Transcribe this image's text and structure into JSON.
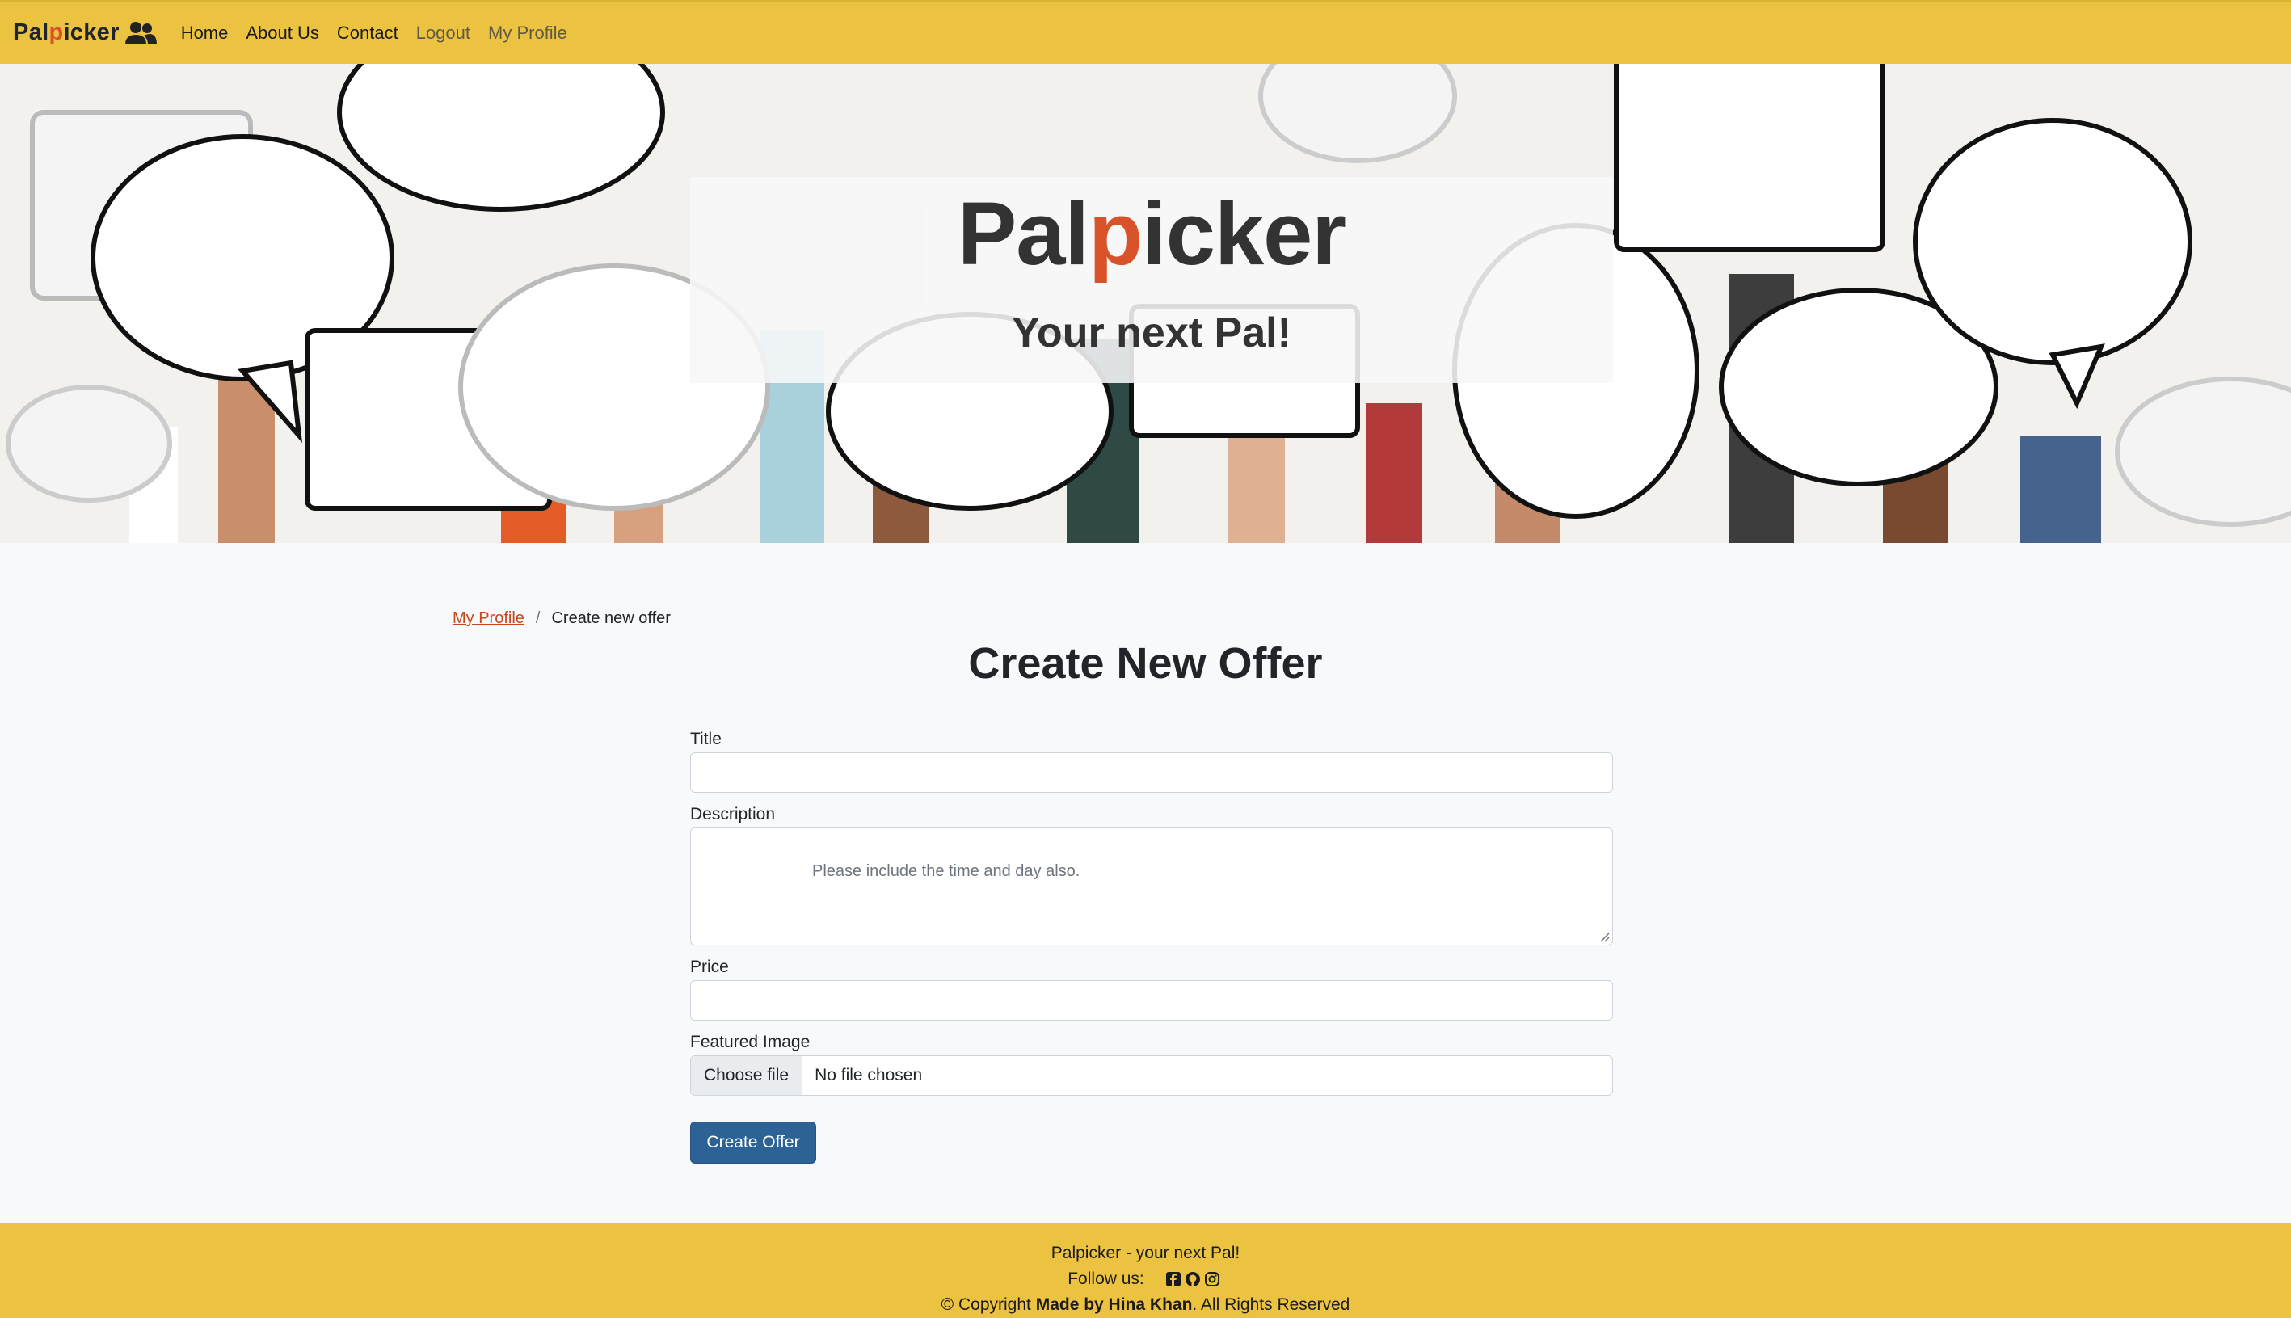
{
  "navbar": {
    "brand_pre": "Pal",
    "brand_p": "p",
    "brand_post": "icker",
    "links": [
      {
        "label": "Home"
      },
      {
        "label": "About Us"
      },
      {
        "label": "Contact"
      },
      {
        "label": "Logout"
      },
      {
        "label": "My Profile"
      }
    ]
  },
  "hero": {
    "title_pre": "Pal",
    "title_p": "p",
    "title_post": "icker",
    "subtitle": "Your next Pal!"
  },
  "breadcrumb": {
    "parent": "My Profile",
    "separator": "/",
    "current": "Create new offer"
  },
  "page_title": "Create New Offer",
  "form": {
    "title_label": "Title",
    "title_value": "",
    "description_label": "Description",
    "description_placeholder": "Please include the time and day also.",
    "price_label": "Price",
    "price_value": "",
    "image_label": "Featured Image",
    "choose_file": "Choose file",
    "file_status": "No file chosen",
    "submit": "Create Offer"
  },
  "footer": {
    "line1": "Palpicker - your next Pal!",
    "follow": "Follow us:",
    "copyright_pre": "© Copyright ",
    "copyright_bold": "Made by Hina Khan",
    "copyright_post": ". All Rights Reserved"
  },
  "colors": {
    "navbar_bg": "#ecc341",
    "accent": "#d9532a",
    "button": "#2c6295",
    "page_bg": "#f8f9fa"
  },
  "icons": [
    "users-icon",
    "facebook-icon",
    "github-icon",
    "instagram-icon"
  ]
}
